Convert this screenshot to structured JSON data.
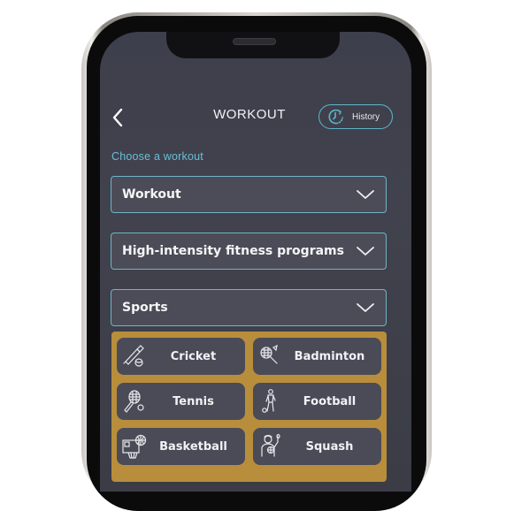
{
  "header": {
    "back_label": "Back",
    "title": "WORKOUT",
    "history_label": "History"
  },
  "section_label": "Choose a workout",
  "dropdowns": [
    {
      "label": "Workout",
      "icon": "chevron-down-icon"
    },
    {
      "label": "High-intensity fitness programs",
      "icon": "chevron-down-icon"
    },
    {
      "label": "Sports",
      "icon": "chevron-down-icon",
      "expanded": true
    }
  ],
  "sports": [
    {
      "label": "Cricket",
      "icon": "cricket-bat-icon"
    },
    {
      "label": "Badminton",
      "icon": "badminton-racket-icon"
    },
    {
      "label": "Tennis",
      "icon": "tennis-racket-icon"
    },
    {
      "label": "Football",
      "icon": "football-player-icon"
    },
    {
      "label": "Basketball",
      "icon": "basketball-hoop-icon"
    },
    {
      "label": "Squash",
      "icon": "squash-player-icon"
    }
  ],
  "colors": {
    "accent": "#5cb6c9",
    "panel": "#b88e3c",
    "tile": "#4a4b57",
    "screen": "#3f404b"
  }
}
